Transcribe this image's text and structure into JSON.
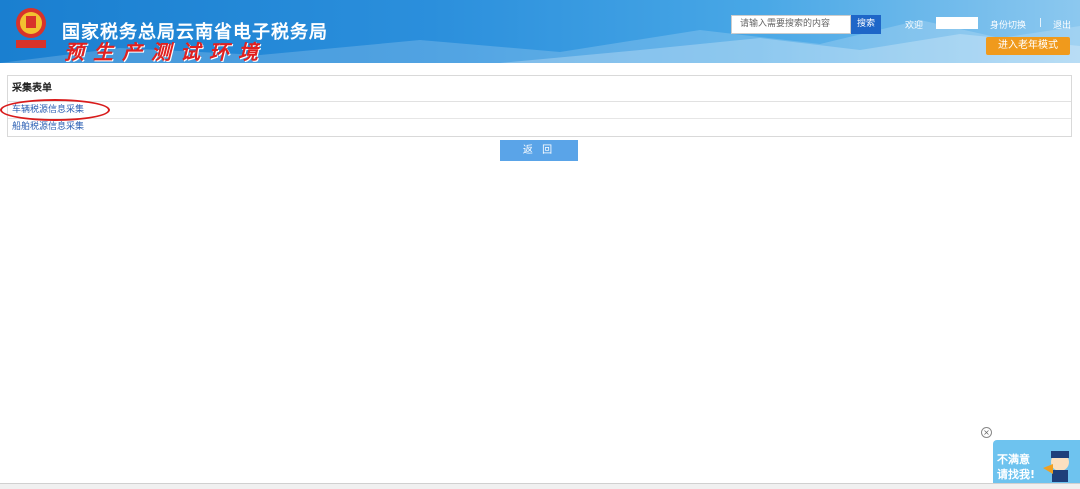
{
  "header": {
    "site_title": "国家税务总局云南省电子税务局",
    "env_title": "预生产测试环境",
    "search_placeholder": "请输入需要搜索的内容",
    "search_button": "搜索",
    "welcome": "欢迎",
    "switch_identity": "身份切换",
    "separator": "|",
    "logout": "退出",
    "elder_mode": "进入老年模式"
  },
  "panel": {
    "title": "采集表单",
    "items": [
      {
        "label": "车辆税源信息采集"
      },
      {
        "label": "船舶税源信息采集"
      }
    ]
  },
  "back_button": "返 回",
  "feedback": {
    "line1": "不满意",
    "line2": "请找我!"
  },
  "close_icon": "×",
  "colors": {
    "header_blue": "#1a7fd0",
    "accent_orange": "#f09a1c",
    "link_blue": "#2b5fb3",
    "annotation_red": "#d81b1b"
  }
}
